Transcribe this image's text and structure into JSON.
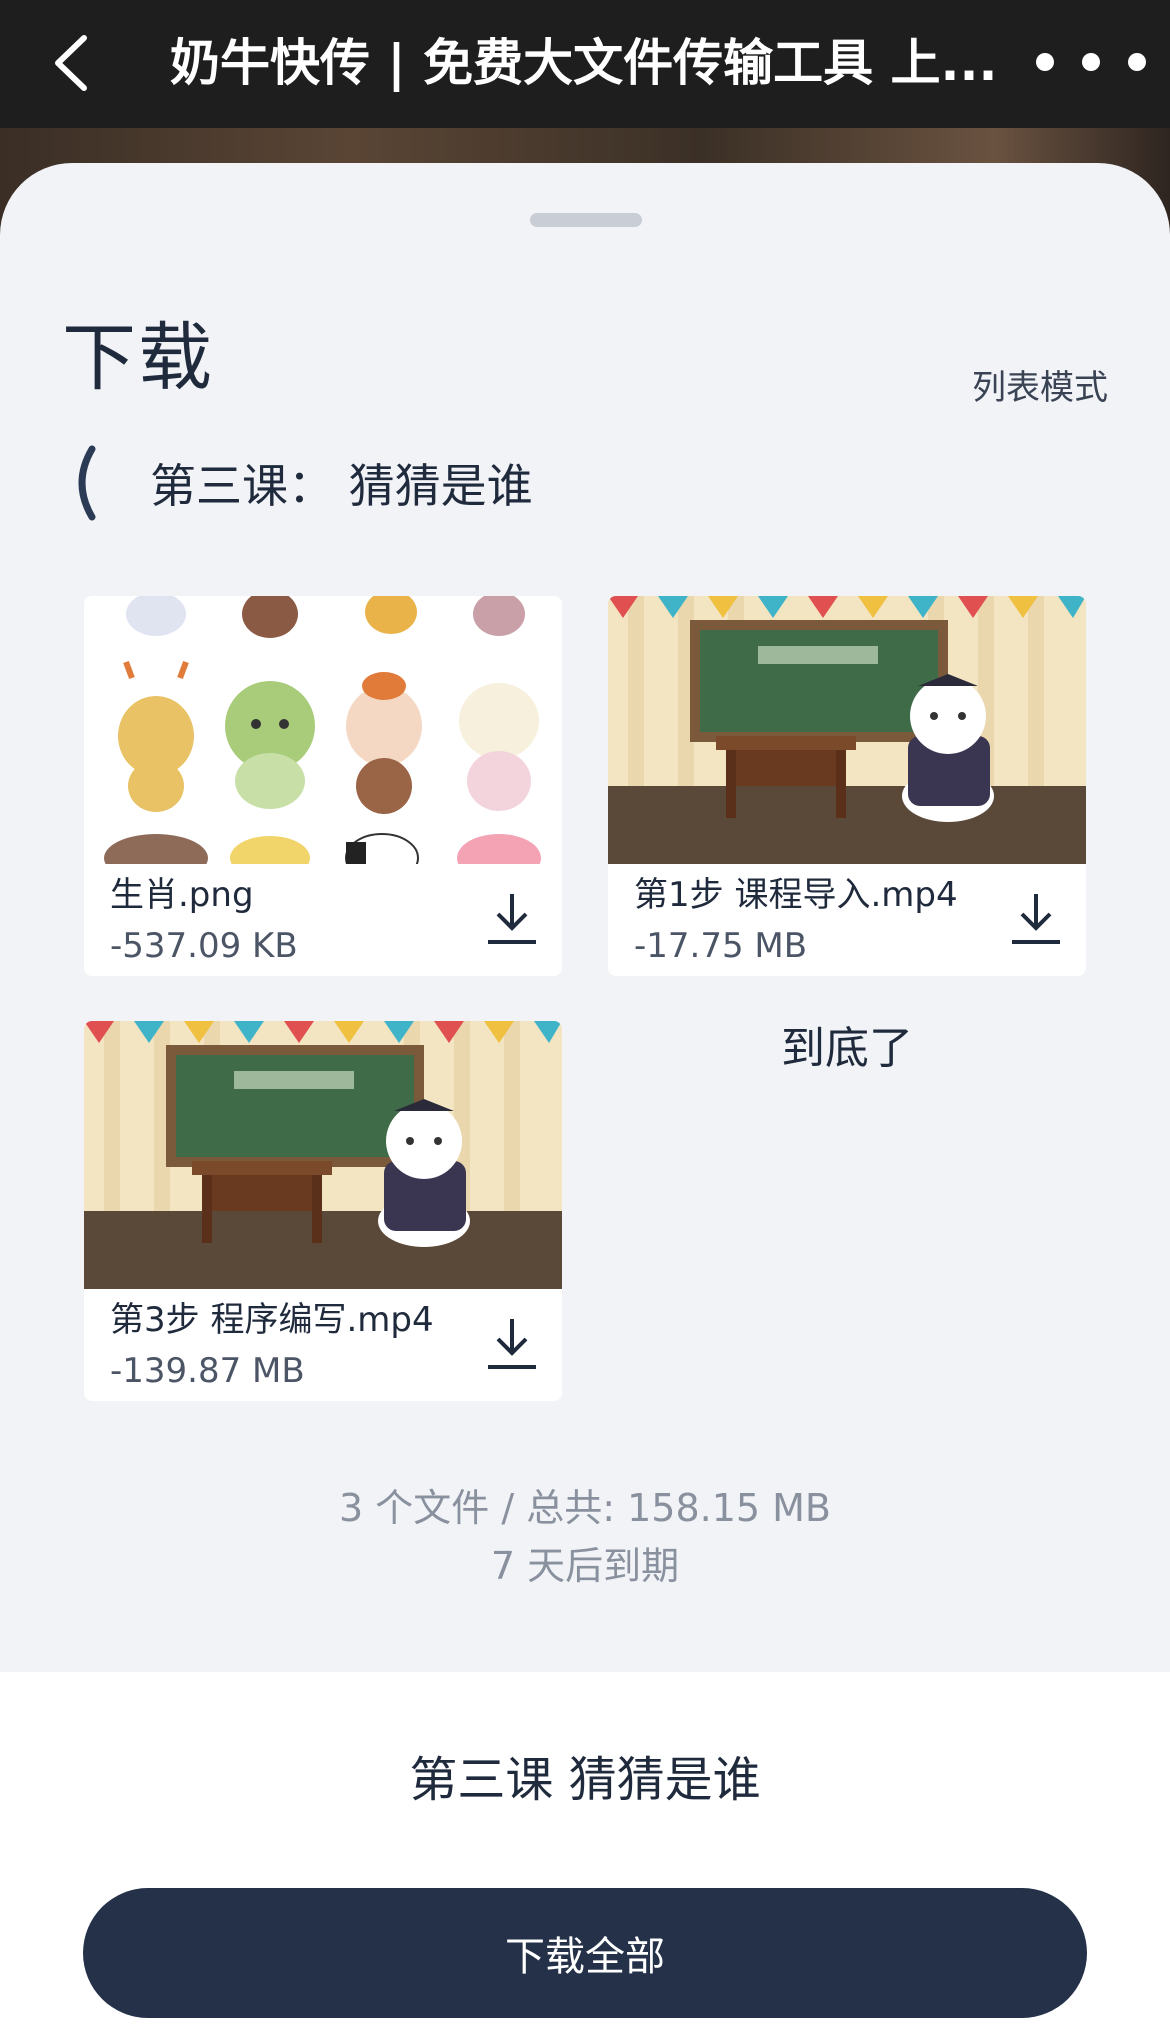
{
  "navbar": {
    "title": "奶牛快传 | 免费大文件传输工具 上...",
    "back_icon": "chevron-left-icon",
    "more_icon": "more-dots-icon"
  },
  "sheet": {
    "title": "下载",
    "view_toggle": "列表模式",
    "folder": {
      "back_icon": "chevron-left-icon",
      "name": "第三课：  猜猜是谁"
    },
    "files": [
      {
        "name": "生肖.png",
        "size": "-537.09 KB",
        "thumbnail": "zodiac-animals-image"
      },
      {
        "name": "第1步 课程导入.mp4",
        "size": "-17.75 MB",
        "thumbnail": "classroom-video-thumbnail"
      },
      {
        "name": "第3步 程序编写.mp4",
        "size": "-139.87 MB",
        "thumbnail": "classroom-video-thumbnail"
      }
    ],
    "end_text": "到底了",
    "summary": {
      "count_total": "3 个文件 / 总共: 158.15 MB",
      "expiry": "7 天后到期"
    }
  },
  "bottom": {
    "title": "第三课 猜猜是谁",
    "download_all": "下载全部"
  },
  "colors": {
    "primary_button": "#243149",
    "sheet_bg": "#f1f3f7",
    "navbar_bg": "#1e1e1e"
  }
}
